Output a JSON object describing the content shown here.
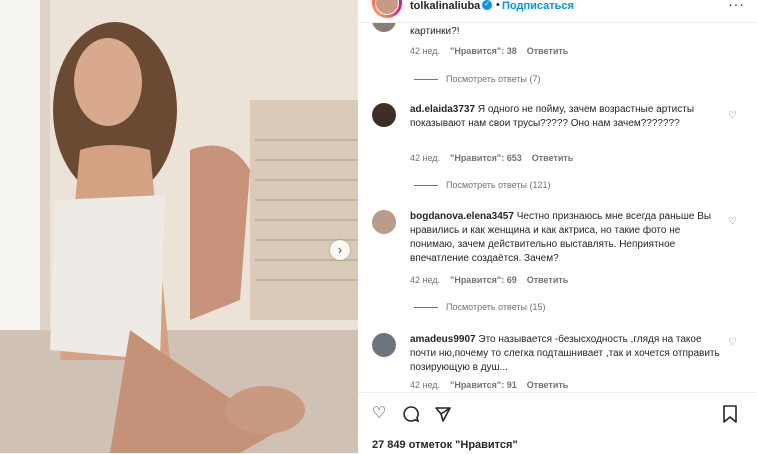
{
  "header": {
    "username": "tolkalinaliuba",
    "separator": "•",
    "follow_label": "Подписаться",
    "more_label": "···",
    "verified_glyph": "✓"
  },
  "carousel": {
    "next_glyph": "›"
  },
  "comments": [
    {
      "username": "",
      "text": "картинки?!",
      "age": "42 нед.",
      "likes": "\"Нравится\": 38",
      "reply_label": "Ответить",
      "view_replies": "Посмотреть ответы (7)"
    },
    {
      "username": "ad.elaida3737",
      "text": "Я одного не пойму, зачем возрастные артисты показывают нам свои трусы????? Оно нам зачем???????",
      "age": "42 нед.",
      "likes": "\"Нравится\": 653",
      "reply_label": "Ответить",
      "view_replies": "Посмотреть ответы (121)"
    },
    {
      "username": "bogdanova.elena3457",
      "text": "Честно признаюсь мне всегда раньше Вы нравились и как женщина и как актриса, но такие фото не понимаю, зачем действительно выставлять. Неприятное впечатление создаётся. Зачем?",
      "age": "42 нед.",
      "likes": "\"Нравится\": 69",
      "reply_label": "Ответить",
      "view_replies": "Посмотреть ответы (15)"
    },
    {
      "username": "amadeus9907",
      "text": "Это называется -безысходность ,глядя на такое почти ню,почему то слегка подташнивает ,так и хочется отправить позирующую в душ...",
      "age": "42 нед.",
      "likes": "\"Нравится\": 91",
      "reply_label": "Ответить",
      "view_replies": ""
    }
  ],
  "actions": {
    "likes_total": "27 849 отметок \"Нравится\""
  },
  "icons": {
    "like": "heart-icon",
    "comment": "comment-icon",
    "share": "share-icon",
    "save": "bookmark-icon"
  },
  "colors": {
    "accent": "#0095f6",
    "muted": "#737373",
    "text": "#262626"
  }
}
